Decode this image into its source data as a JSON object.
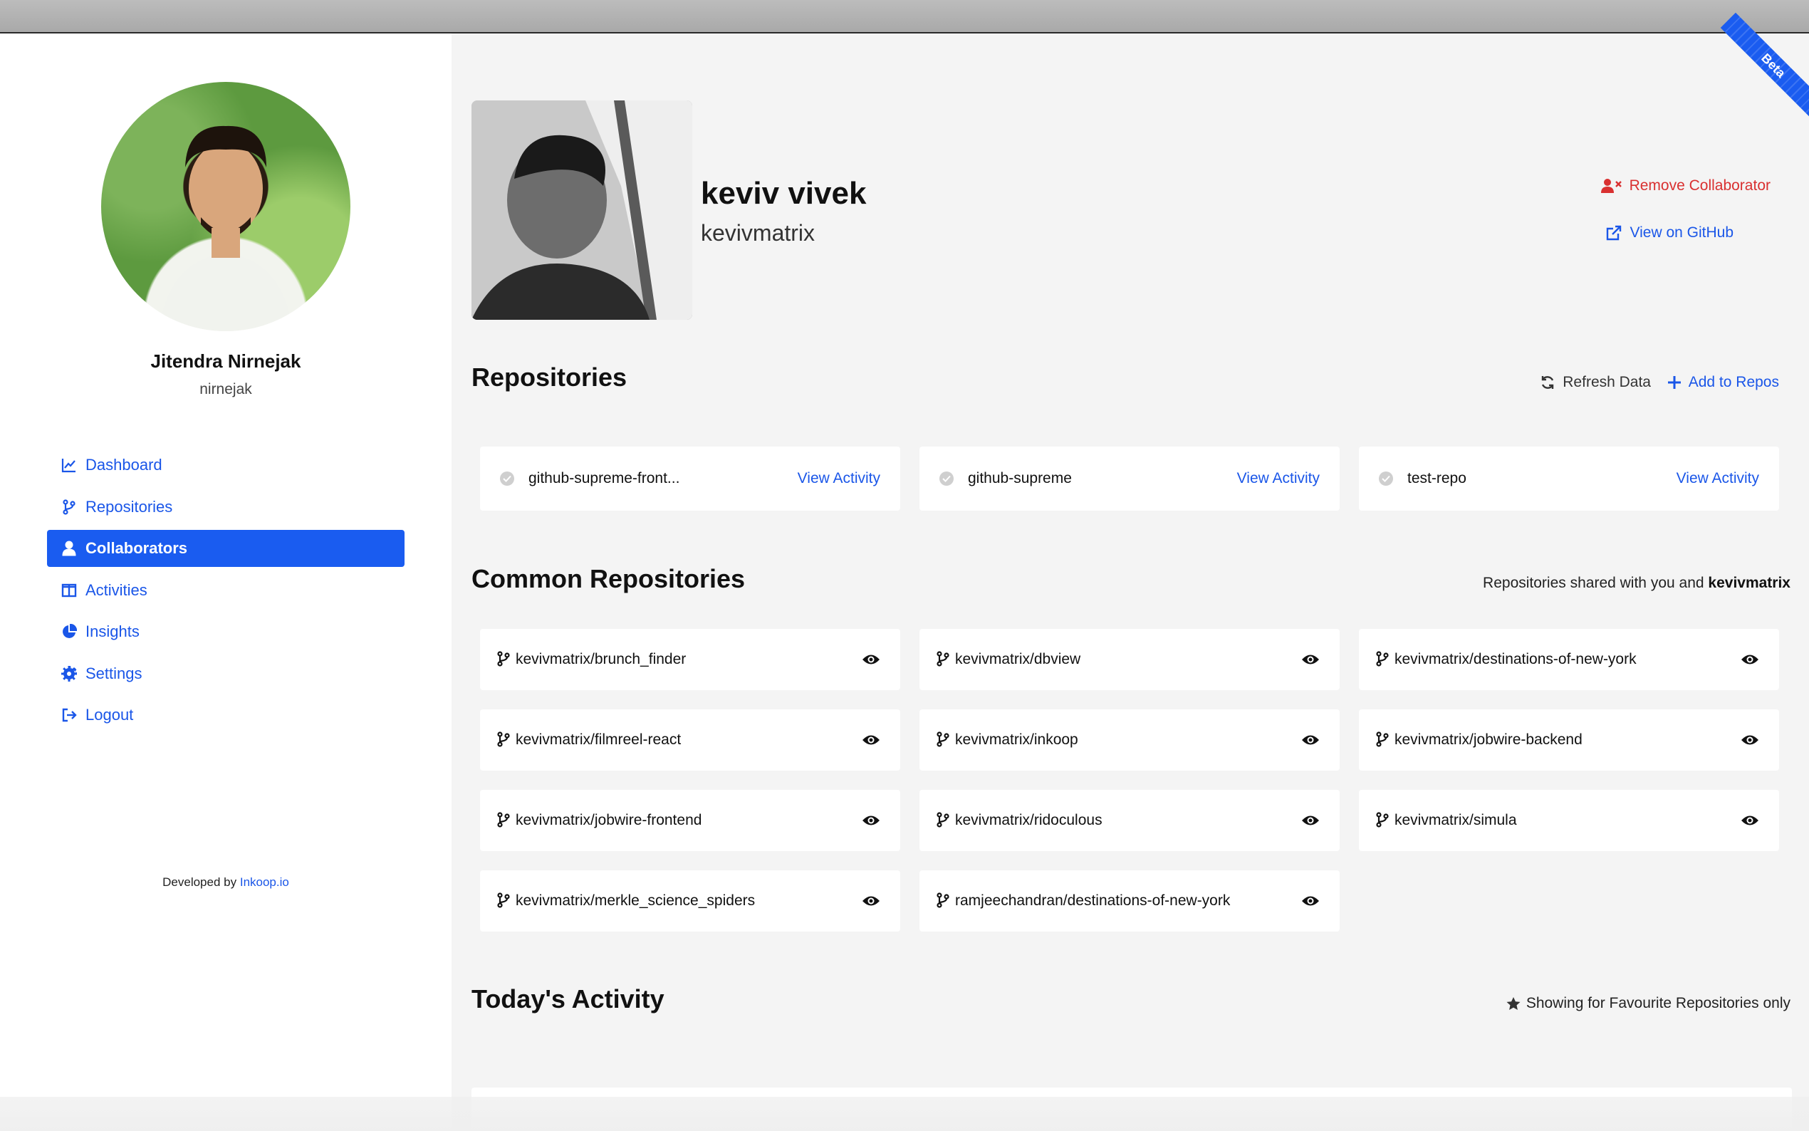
{
  "sidebar": {
    "user_name": "Jitendra Nirnejak",
    "user_handle": "nirnejak",
    "nav": [
      {
        "label": "Dashboard",
        "icon": "chart-line-icon"
      },
      {
        "label": "Repositories",
        "icon": "code-branch-icon"
      },
      {
        "label": "Collaborators",
        "icon": "user-icon",
        "active": true
      },
      {
        "label": "Activities",
        "icon": "columns-icon"
      },
      {
        "label": "Insights",
        "icon": "pie-chart-icon"
      },
      {
        "label": "Settings",
        "icon": "gear-icon"
      },
      {
        "label": "Logout",
        "icon": "sign-out-icon"
      }
    ],
    "credit_prefix": "Developed by",
    "credit_link": "Inkoop.io"
  },
  "ribbon": "Beta",
  "profile": {
    "name": "keviv vivek",
    "login": "kevivmatrix",
    "remove_label": "Remove Collaborator",
    "github_label": "View on GitHub"
  },
  "repositories": {
    "title": "Repositories",
    "refresh_label": "Refresh Data",
    "add_label": "Add to Repos",
    "items": [
      {
        "name": "github-supreme-front...",
        "action": "View Activity"
      },
      {
        "name": "github-supreme",
        "action": "View Activity"
      },
      {
        "name": "test-repo",
        "action": "View Activity"
      }
    ]
  },
  "common": {
    "title": "Common Repositories",
    "note_prefix": "Repositories shared with you and",
    "note_user": "kevivmatrix",
    "items": [
      "kevivmatrix/brunch_finder",
      "kevivmatrix/dbview",
      "kevivmatrix/destinations-of-new-york",
      "kevivmatrix/filmreel-react",
      "kevivmatrix/inkoop",
      "kevivmatrix/jobwire-backend",
      "kevivmatrix/jobwire-frontend",
      "kevivmatrix/ridoculous",
      "kevivmatrix/simula",
      "kevivmatrix/merkle_science_spiders",
      "ramjeechandran/destinations-of-new-york"
    ]
  },
  "activity": {
    "title": "Today's Activity",
    "note": "Showing for Favourite Repositories only"
  },
  "colors": {
    "accent": "#1a5cf0",
    "danger": "#d93030",
    "background": "#f4f4f4"
  }
}
